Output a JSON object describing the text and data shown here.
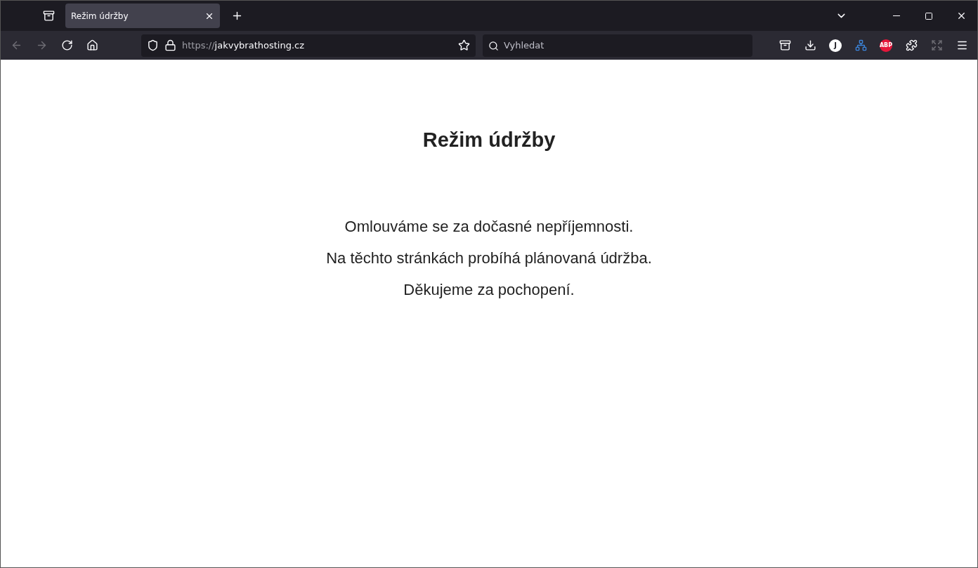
{
  "tabs": [
    {
      "label": "Režim údržby",
      "selected": true
    }
  ],
  "nav": [
    {
      "kind": "back",
      "disabled": true
    },
    {
      "kind": "forward",
      "disabled": true
    },
    {
      "kind": "reload",
      "disabled": false
    },
    {
      "kind": "home",
      "disabled": false
    }
  ],
  "address": {
    "scheme": "https://",
    "host": "jakvybrathosting.cz"
  },
  "search": {
    "placeholder": "Vyhledat"
  },
  "extensions": [
    {
      "kind": "pocket"
    },
    {
      "kind": "download"
    },
    {
      "kind": "letter",
      "text": "J"
    },
    {
      "kind": "sitemap"
    },
    {
      "kind": "abp",
      "text": "ABP"
    },
    {
      "kind": "puzzle"
    },
    {
      "kind": "expand"
    },
    {
      "kind": "menu"
    }
  ],
  "page": {
    "title": "Režim údržby",
    "lines": [
      "Omlouváme se za dočasné nepříjemnosti.",
      "Na těchto stránkách probíhá plánovaná údržba.",
      "Děkujeme za pochopení."
    ]
  }
}
